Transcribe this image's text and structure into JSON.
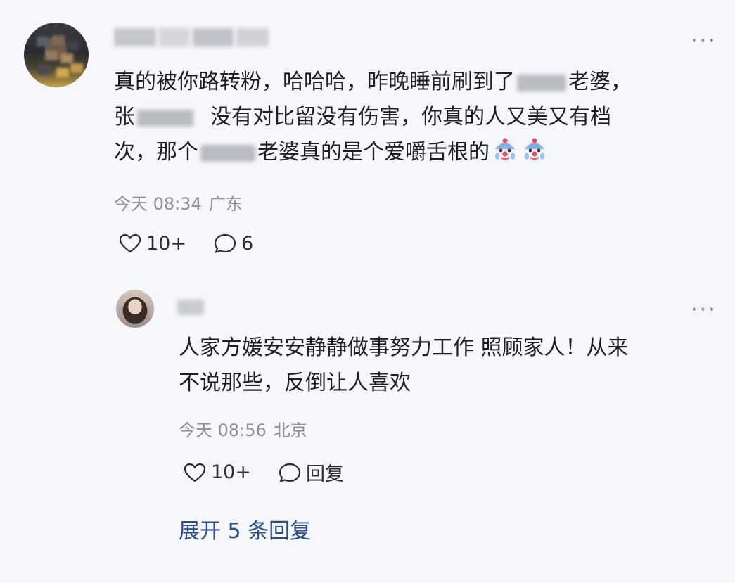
{
  "main_comment": {
    "text_line1_a": "真的被你路转粉，哈哈哈，昨晚睡前刷到了",
    "text_line1_b": "老婆，",
    "text_line2_a": "张",
    "text_line2_b": "没有对比留没有伤害，你真的人又美又有档",
    "text_line3_a": "次，那个",
    "text_line3_b": "老婆真的是个爱嚼舌根的",
    "emoji_icon": "clown-crying-emoji",
    "time": "今天 08:34",
    "location": "广东",
    "likes": "10+",
    "comments": "6",
    "more_label": "···"
  },
  "reply": {
    "text_line1": "人家方媛安安静静做事努力工作 照顾家人！从来",
    "text_line2": "不说那些，反倒让人喜欢",
    "time": "今天 08:56",
    "location": "北京",
    "likes": "10+",
    "reply_label": "回复",
    "more_label": "···"
  },
  "expand_label": "展开 5 条回复",
  "colors": {
    "background": "#f6f7fb",
    "text": "#1d1f24",
    "meta": "#8d9098",
    "link": "#2a4d92"
  }
}
